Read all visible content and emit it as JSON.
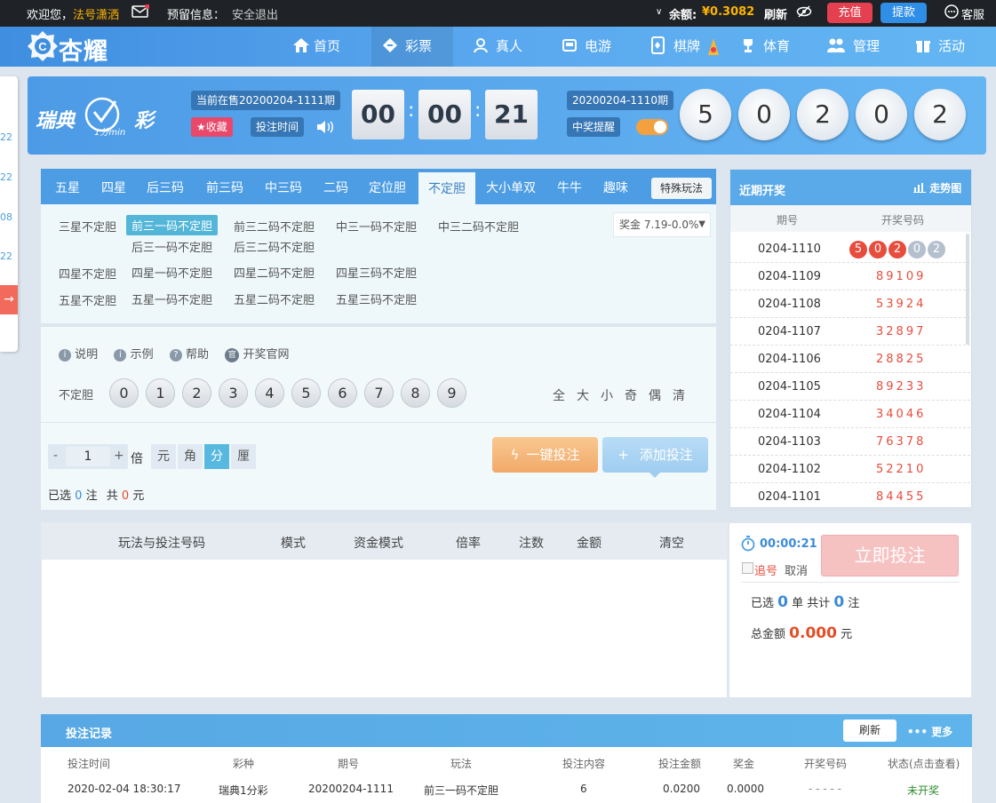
{
  "topbar": {
    "welcome": "欢迎您，",
    "username": "法号潇洒",
    "reserved_info": "预留信息：",
    "logout": "安全退出",
    "balance_label": "余额:",
    "balance_value": "¥0.3082",
    "refresh": "刷新",
    "recharge": "充值",
    "withdraw": "提款",
    "service": "客服",
    "colors": {
      "recharge": "#e5404f",
      "withdraw": "#2f8ee6",
      "balance": "#ffb400"
    }
  },
  "nav": {
    "logo": "杏耀",
    "items": [
      {
        "label": "首页",
        "icon": "home-icon"
      },
      {
        "label": "彩票",
        "icon": "ticket-icon"
      },
      {
        "label": "真人",
        "icon": "dealer-icon"
      },
      {
        "label": "电游",
        "icon": "slot-machine-icon"
      },
      {
        "label": "棋牌",
        "icon": "cards-icon"
      },
      {
        "label": "体育",
        "icon": "trophy-icon"
      },
      {
        "label": "管理",
        "icon": "users-icon"
      },
      {
        "label": "活动",
        "icon": "gift-icon"
      }
    ]
  },
  "leftstrip": {
    "nums": [
      "22",
      "22",
      "08",
      "22"
    ],
    "arrow": "→"
  },
  "banner": {
    "game_logo_text": "瑞典",
    "game_logo_sub": "1分min",
    "game_logo_suffix": "彩",
    "current_sale": "当前在售20200204-1111期",
    "favorite": "★收藏",
    "bet_time": "投注时间",
    "countdown": {
      "h": "00",
      "m": "00",
      "s": "21"
    },
    "last_issue": "20200204-1110期",
    "win_alert": "中奖提醒",
    "result": [
      "5",
      "0",
      "2",
      "0",
      "2"
    ]
  },
  "tabs": {
    "items": [
      "五星",
      "四星",
      "后三码",
      "前三码",
      "中三码",
      "二码",
      "定位胆",
      "不定胆",
      "大小单双",
      "牛牛",
      "趣味"
    ],
    "active": "不定胆",
    "special": "特殊玩法"
  },
  "subplays": {
    "row1_label": "三星不定胆",
    "row1": [
      "前三一码不定胆",
      "前三二码不定胆",
      "中三一码不定胆",
      "中三二码不定胆"
    ],
    "row1b": [
      "后三一码不定胆",
      "后三二码不定胆"
    ],
    "row2_label": "四星不定胆",
    "row2": [
      "四星一码不定胆",
      "四星二码不定胆",
      "四星三码不定胆"
    ],
    "row3_label": "五星不定胆",
    "row3": [
      "五星一码不定胆",
      "五星二码不定胆",
      "五星三码不定胆"
    ],
    "prize": "奖金 7.19-0.0%"
  },
  "betarea": {
    "links": [
      "说明",
      "示例",
      "帮助",
      "开奖官网"
    ],
    "row_label": "不定胆",
    "numbers": [
      "0",
      "1",
      "2",
      "3",
      "4",
      "5",
      "6",
      "7",
      "8",
      "9"
    ],
    "quick": [
      "全",
      "大",
      "小",
      "奇",
      "偶",
      "清"
    ],
    "multiplier": "1",
    "minus": "-",
    "plus": "+",
    "times": "倍",
    "units": [
      "元",
      "角",
      "分",
      "厘"
    ],
    "active_unit": "分",
    "one_click": "一键投注",
    "add_bet": "添加投注",
    "selected_prefix": "已选",
    "selected_count": "0",
    "selected_unit": "注",
    "total_prefix": "共",
    "total_amount": "0",
    "total_unit": "元"
  },
  "history": {
    "title": "近期开奖",
    "trend": "走势图",
    "col_issue": "期号",
    "col_numbers": "开奖号码",
    "rows": [
      {
        "issue": "0204-1110",
        "numbers": [
          "5",
          "0",
          "2",
          "0",
          "2"
        ]
      },
      {
        "issue": "0204-1109",
        "numbers": [
          "8",
          "9",
          "1",
          "0",
          "9"
        ]
      },
      {
        "issue": "0204-1108",
        "numbers": [
          "5",
          "3",
          "9",
          "2",
          "4"
        ]
      },
      {
        "issue": "0204-1107",
        "numbers": [
          "3",
          "2",
          "8",
          "9",
          "7"
        ]
      },
      {
        "issue": "0204-1106",
        "numbers": [
          "2",
          "8",
          "8",
          "2",
          "5"
        ]
      },
      {
        "issue": "0204-1105",
        "numbers": [
          "8",
          "9",
          "2",
          "3",
          "3"
        ]
      },
      {
        "issue": "0204-1104",
        "numbers": [
          "3",
          "4",
          "0",
          "4",
          "6"
        ]
      },
      {
        "issue": "0204-1103",
        "numbers": [
          "7",
          "6",
          "3",
          "7",
          "8"
        ]
      },
      {
        "issue": "0204-1102",
        "numbers": [
          "5",
          "2",
          "2",
          "1",
          "0"
        ]
      },
      {
        "issue": "0204-1101",
        "numbers": [
          "8",
          "4",
          "4",
          "5",
          "5"
        ]
      }
    ]
  },
  "cart": {
    "headers": [
      "玩法与投注号码",
      "模式",
      "资金模式",
      "倍率",
      "注数",
      "金额",
      "清空"
    ]
  },
  "submit": {
    "timer": "00:00:21",
    "chase": "追号",
    "cancel": "取消",
    "button": "立即投注",
    "sel_prefix": "已选",
    "sel_count": "0",
    "sel_mid": "单 共计",
    "sel_bets": "0",
    "sel_unit": "注",
    "total_label": "总金额",
    "total_value": "0.000",
    "total_unit": "元"
  },
  "records": {
    "title": "投注记录",
    "refresh": "刷新",
    "more": "更多",
    "headers": [
      "投注时间",
      "彩种",
      "期号",
      "玩法",
      "投注内容",
      "投注金额",
      "奖金",
      "开奖号码",
      "状态(点击查看)"
    ],
    "row": [
      "2020-02-04 18:30:17",
      "瑞典1分彩",
      "20200204-1111",
      "前三一码不定胆",
      "6",
      "0.0200",
      "0.0000",
      "- - - - -",
      "未开奖"
    ]
  }
}
